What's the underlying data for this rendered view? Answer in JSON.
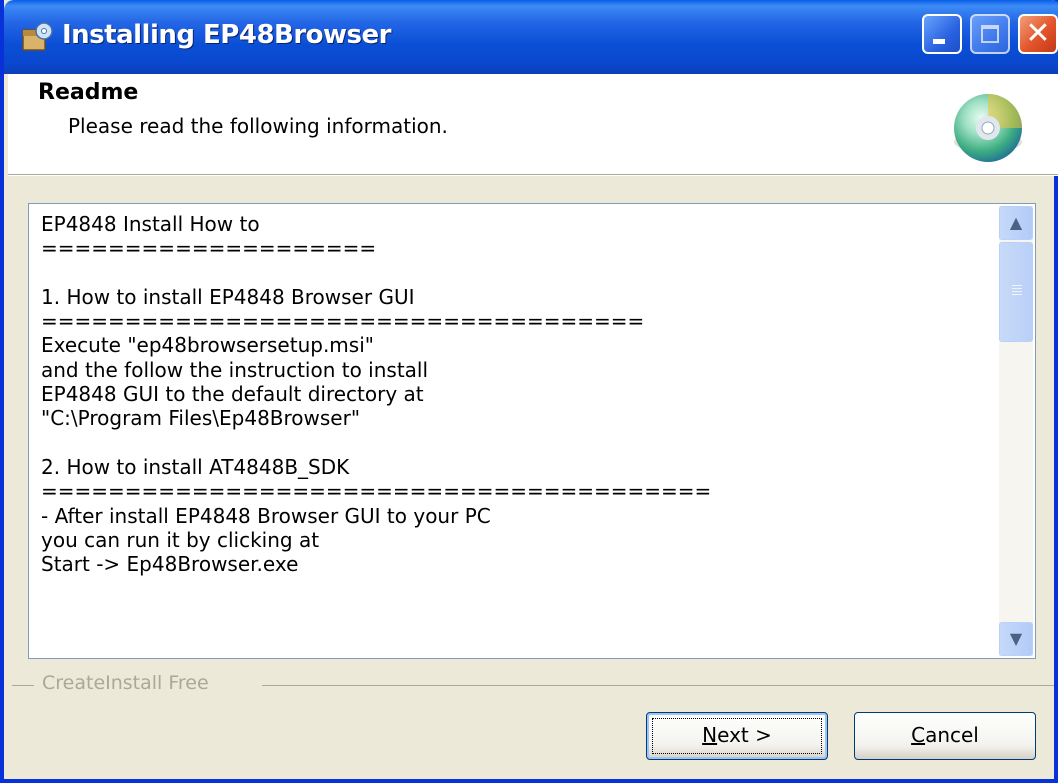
{
  "window": {
    "title": "Installing EP48Browser",
    "controls": [
      "minimize",
      "maximize",
      "close"
    ]
  },
  "header": {
    "title": "Readme",
    "subtitle": "Please read the following information."
  },
  "readme": {
    "lines": [
      "EP4848 Install How to",
      "====================",
      "",
      "1. How to install EP4848 Browser GUI",
      "====================================",
      "Execute \"ep48browsersetup.msi\"",
      "and the follow the instruction to install",
      "EP4848 GUI to the default directory at",
      "\"C:\\Program Files\\Ep48Browser\"",
      "",
      "2. How to install AT4848B_SDK",
      "========================================",
      "- After install EP4848 Browser GUI to your PC",
      "you can run it by clicking at",
      "Start -> Ep48Browser.exe"
    ]
  },
  "brand": "CreateInstall Free",
  "buttons": {
    "next": {
      "mnemonic": "N",
      "rest": "ext >"
    },
    "cancel": {
      "mnemonic": "C",
      "rest": "ancel"
    }
  },
  "icons": {
    "title": "installer-icon",
    "header": "cd-disc-icon"
  }
}
